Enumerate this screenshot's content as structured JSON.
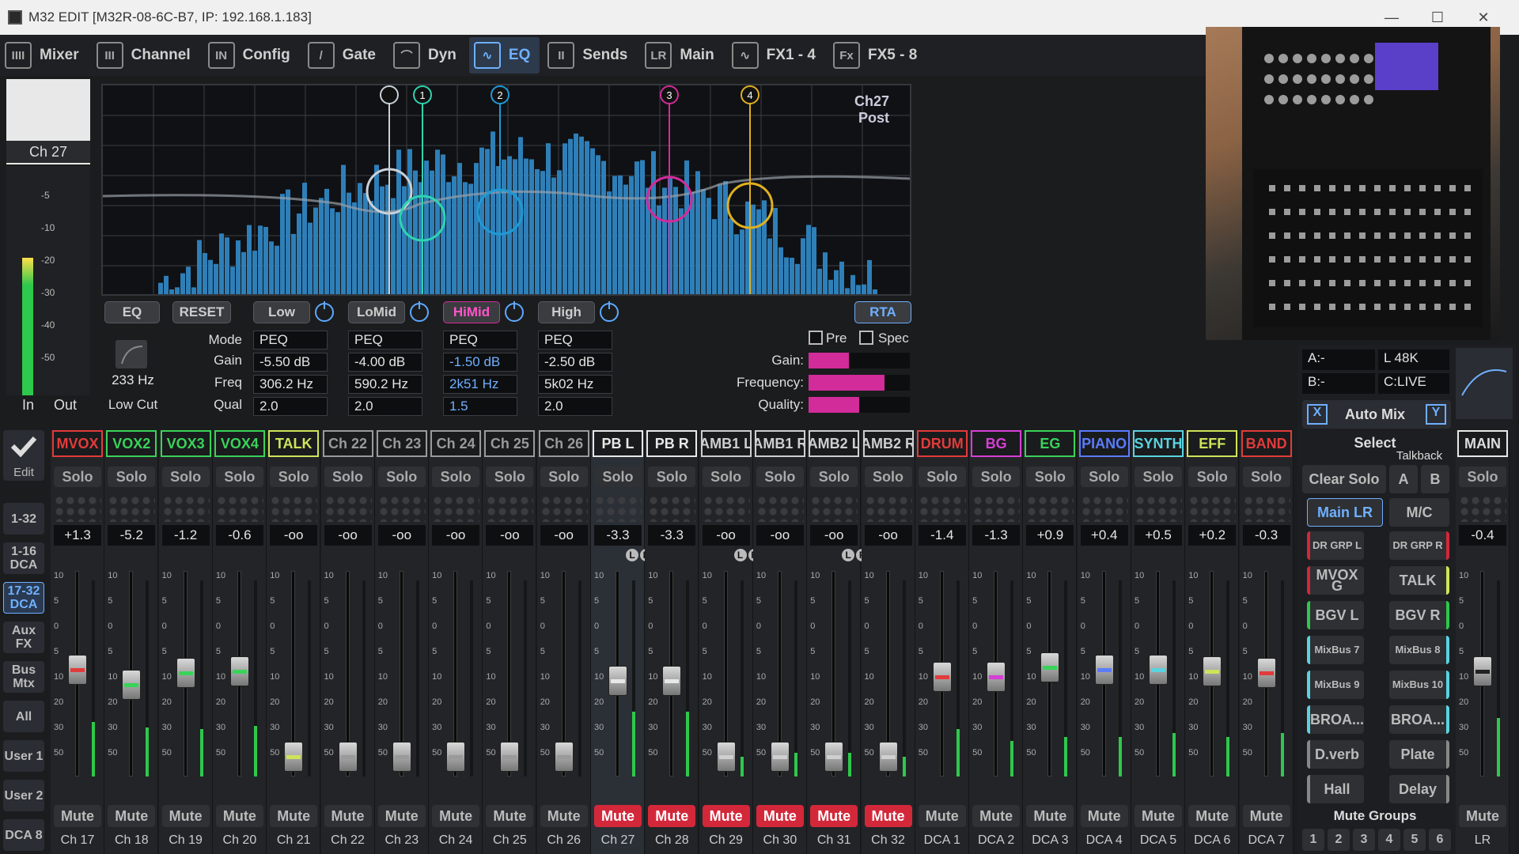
{
  "window": {
    "title": "M32 EDIT [M32R-08-6C-B7, IP: 192.168.1.183]",
    "minimize": "—",
    "maximize": "☐",
    "close": "✕"
  },
  "toolbar": {
    "tabs": [
      {
        "label": "Mixer",
        "icon": "IIII"
      },
      {
        "label": "Channel",
        "icon": "III"
      },
      {
        "label": "Config",
        "icon": "IN"
      },
      {
        "label": "Gate",
        "icon": "/"
      },
      {
        "label": "Dyn",
        "icon": "⌒"
      },
      {
        "label": "EQ",
        "icon": "∿"
      },
      {
        "label": "Sends",
        "icon": "II"
      },
      {
        "label": "Main",
        "icon": "LR"
      },
      {
        "label": "FX1 - 4",
        "icon": "∿"
      },
      {
        "label": "FX5 - 8",
        "icon": "Fx"
      }
    ]
  },
  "selected": {
    "name": "PB L",
    "channel": "Ch 27",
    "meter_in": "In",
    "meter_out": "Out",
    "scale": [
      "-5",
      "-10",
      "-20",
      "-30",
      "-40",
      "-50"
    ],
    "level": 0.6
  },
  "eq": {
    "tag1": "Ch27",
    "tag2": "Post",
    "btn_eq": "EQ",
    "btn_reset": "RESET",
    "btn_rta": "RTA",
    "lowcut_freq": "233 Hz",
    "lowcut_label": "Low Cut",
    "row_labels": {
      "mode": "Mode",
      "gain": "Gain",
      "freq": "Freq",
      "qual": "Qual"
    },
    "bands": [
      {
        "name": "Low",
        "mode": "PEQ",
        "gain": "-5.50 dB",
        "freq": "306.2 Hz",
        "q": "2.0",
        "num": "1"
      },
      {
        "name": "LoMid",
        "mode": "PEQ",
        "gain": "-4.00 dB",
        "freq": "590.2 Hz",
        "q": "2.0",
        "num": "2"
      },
      {
        "name": "HiMid",
        "mode": "PEQ",
        "gain": "-1.50 dB",
        "freq": "2k51 Hz",
        "q": "1.5",
        "num": "3"
      },
      {
        "name": "High",
        "mode": "PEQ",
        "gain": "-2.50 dB",
        "freq": "5k02 Hz",
        "q": "2.0",
        "num": "4"
      }
    ],
    "pre": "Pre",
    "spec": "Spec",
    "sel_gain_label": "Gain:",
    "sel_freq_label": "Frequency:",
    "sel_q_label": "Quality:",
    "sel_gain": 0.4,
    "sel_freq": 0.75,
    "sel_q": 0.5
  },
  "strips": [
    {
      "name": "MVOX",
      "color": "#e23b3b",
      "val": "+1.3",
      "ch": "Ch 17",
      "fader": 0.56,
      "meter": 0.28,
      "mute": false
    },
    {
      "name": "VOX2",
      "color": "#39d35a",
      "val": "-5.2",
      "ch": "Ch 18",
      "fader": 0.48,
      "meter": 0.25,
      "mute": false
    },
    {
      "name": "VOX3",
      "color": "#39d35a",
      "val": "-1.2",
      "ch": "Ch 19",
      "fader": 0.54,
      "meter": 0.24,
      "mute": false
    },
    {
      "name": "VOX4",
      "color": "#39d35a",
      "val": "-0.6",
      "ch": "Ch 20",
      "fader": 0.55,
      "meter": 0.26,
      "mute": false
    },
    {
      "name": "TALK",
      "color": "#cfe35a",
      "val": "-oo",
      "ch": "Ch 21",
      "fader": 0.1,
      "meter": 0,
      "mute": false
    },
    {
      "name": "Ch 22",
      "color": "#9a9a9a",
      "val": "-oo",
      "ch": "Ch 22",
      "fader": 0.1,
      "meter": 0,
      "mute": false
    },
    {
      "name": "Ch 23",
      "color": "#9a9a9a",
      "val": "-oo",
      "ch": "Ch 23",
      "fader": 0.1,
      "meter": 0,
      "mute": false
    },
    {
      "name": "Ch 24",
      "color": "#9a9a9a",
      "val": "-oo",
      "ch": "Ch 24",
      "fader": 0.1,
      "meter": 0,
      "mute": false
    },
    {
      "name": "Ch 25",
      "color": "#9a9a9a",
      "val": "-oo",
      "ch": "Ch 25",
      "fader": 0.1,
      "meter": 0,
      "mute": false
    },
    {
      "name": "Ch 26",
      "color": "#9a9a9a",
      "val": "-oo",
      "ch": "Ch 26",
      "fader": 0.1,
      "meter": 0,
      "mute": false
    },
    {
      "name": "PB L",
      "color": "#e8e8e8",
      "val": "-3.3",
      "ch": "Ch 27",
      "fader": 0.5,
      "meter": 0.33,
      "mute": true,
      "lr": true
    },
    {
      "name": "PB R",
      "color": "#e8e8e8",
      "val": "-3.3",
      "ch": "Ch 28",
      "fader": 0.5,
      "meter": 0.33,
      "mute": true
    },
    {
      "name": "AMB1 L",
      "color": "#cfcfcf",
      "val": "-oo",
      "ch": "Ch 29",
      "fader": 0.1,
      "meter": 0.1,
      "mute": true,
      "lr": true
    },
    {
      "name": "AMB1 R",
      "color": "#cfcfcf",
      "val": "-oo",
      "ch": "Ch 30",
      "fader": 0.1,
      "meter": 0.12,
      "mute": true
    },
    {
      "name": "AMB2 L",
      "color": "#cfcfcf",
      "val": "-oo",
      "ch": "Ch 31",
      "fader": 0.1,
      "meter": 0.12,
      "mute": true,
      "lr": true
    },
    {
      "name": "AMB2 R",
      "color": "#cfcfcf",
      "val": "-oo",
      "ch": "Ch 32",
      "fader": 0.1,
      "meter": 0.1,
      "mute": true
    },
    {
      "name": "DRUM",
      "color": "#e23b3b",
      "val": "-1.4",
      "ch": "DCA 1",
      "fader": 0.52,
      "meter": 0.24,
      "mute": false
    },
    {
      "name": "BG",
      "color": "#d63fd6",
      "val": "-1.3",
      "ch": "DCA 2",
      "fader": 0.52,
      "meter": 0.18,
      "mute": false
    },
    {
      "name": "EG",
      "color": "#39d35a",
      "val": "+0.9",
      "ch": "DCA 3",
      "fader": 0.57,
      "meter": 0.2,
      "mute": false
    },
    {
      "name": "PIANO",
      "color": "#5a7cff",
      "val": "+0.4",
      "ch": "DCA 4",
      "fader": 0.56,
      "meter": 0.2,
      "mute": false
    },
    {
      "name": "SYNTH",
      "color": "#5ad3e0",
      "val": "+0.5",
      "ch": "DCA 5",
      "fader": 0.56,
      "meter": 0.22,
      "mute": false
    },
    {
      "name": "EFF",
      "color": "#cfe35a",
      "val": "+0.2",
      "ch": "DCA 6",
      "fader": 0.55,
      "meter": 0.2,
      "mute": false
    },
    {
      "name": "BAND",
      "color": "#e23b3b",
      "val": "-0.3",
      "ch": "DCA 7",
      "fader": 0.54,
      "meter": 0.22,
      "mute": false
    }
  ],
  "solo_label": "Solo",
  "mute_label": "Mute",
  "scale": [
    "10",
    "5",
    "0",
    "5",
    "10",
    "20",
    "30",
    "50"
  ],
  "lr_l": "L",
  "lr_r": "R",
  "left_buttons": {
    "edit": "Edit",
    "banks": [
      "1-32",
      "1-16 DCA",
      "17-32 DCA",
      "Aux FX",
      "Bus Mtx",
      "All",
      "User 1",
      "User 2",
      "DCA 8"
    ]
  },
  "right": {
    "a": "A:-",
    "b": "B:-",
    "l48": "L  48K",
    "clive": "C:LIVE",
    "automix": "Auto Mix",
    "x": "X",
    "y": "Y",
    "select": "Select",
    "talkback": "Talkback",
    "clear_solo": "Clear Solo",
    "ta": "A",
    "tb": "B",
    "main_lr": "Main LR",
    "mc": "M/C",
    "grid": [
      [
        "DR GRP L",
        "DR GRP R"
      ],
      [
        "MVOX G",
        "TALK"
      ],
      [
        "BGV L",
        "BGV R"
      ],
      [
        "MixBus 7",
        "MixBus 8"
      ],
      [
        "MixBus 9",
        "MixBus 10"
      ],
      [
        "BROA...",
        "BROA..."
      ],
      [
        "D.verb",
        "Plate"
      ],
      [
        "Hall",
        "Delay"
      ]
    ],
    "mute_groups": "Mute Groups",
    "mg": [
      "1",
      "2",
      "3",
      "4",
      "5",
      "6"
    ],
    "main": {
      "name": "MAIN",
      "val": "-0.4",
      "mute": "Mute",
      "lr": "LR",
      "fader": 0.55,
      "meter": 0.3
    }
  }
}
